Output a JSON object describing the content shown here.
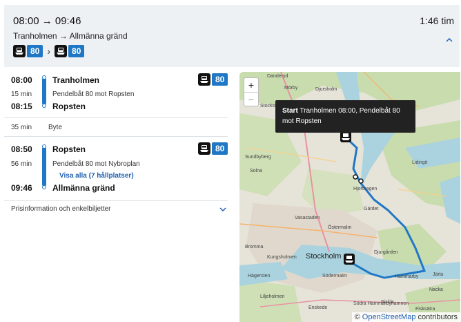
{
  "header": {
    "time": "08:00 → 09:46",
    "route": "Tranholmen → Allmänna gränd",
    "duration": "1:46 tim",
    "lines": [
      "80",
      "80"
    ]
  },
  "legs": [
    {
      "dep_time": "08:00",
      "dep_stop": "Tranholmen",
      "duration": "15 min",
      "description": "Pendelbåt 80 mot Ropsten",
      "arr_time": "08:15",
      "arr_stop": "Ropsten",
      "line": "80"
    },
    {
      "dep_time": "08:50",
      "dep_stop": "Ropsten",
      "duration": "56 min",
      "description": "Pendelbåt 80 mot Nybroplan",
      "link": "Visa alla (7 hållplatser)",
      "arr_time": "09:46",
      "arr_stop": "Allmänna gränd",
      "line": "80"
    }
  ],
  "transfer": {
    "duration": "35 min",
    "label": "Byte"
  },
  "price_info": "Prisinformation och enkelbiljetter",
  "map": {
    "zoom_in": "+",
    "zoom_out": "−",
    "tooltip_bold": "Start",
    "tooltip_text": "Tranholmen 08:00, Pendelbåt 80 mot Ropsten",
    "attribution_symbol": "©",
    "attribution_link": "OpenStreetMap",
    "attribution_suffix": "contributors",
    "city_label": "Stockholm",
    "place_labels": [
      "Danderyd",
      "Mörby",
      "Djursholm",
      "Lidingö",
      "Stocksund",
      "Solna",
      "Sundbyberg",
      "Hjorthagen",
      "Östermalm",
      "Södermalm",
      "Nacka",
      "Hammarby",
      "Hägersten",
      "Liljeholmen",
      "Bromma",
      "Kungsholmen",
      "Vasastaden",
      "Djurgården",
      "Järla",
      "Sickla",
      "Enskede",
      "Gärdet",
      "Södra Hammarbyhamnen",
      "Fisksätra"
    ],
    "route_color": "#1f77c5"
  }
}
